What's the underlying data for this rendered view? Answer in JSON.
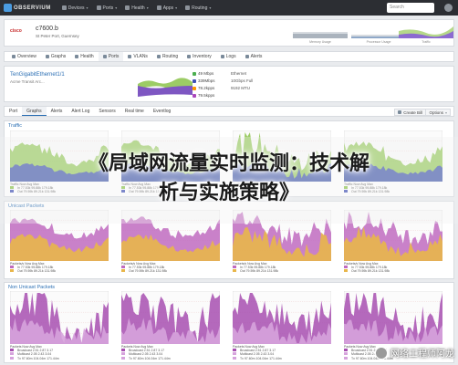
{
  "topbar": {
    "logo": "OBSERVIUM",
    "nav": [
      {
        "label": "Devices",
        "icon": "devices-icon"
      },
      {
        "label": "Ports",
        "icon": "ports-icon"
      },
      {
        "label": "Health",
        "icon": "health-icon"
      },
      {
        "label": "Apps",
        "icon": "apps-icon"
      },
      {
        "label": "Routing",
        "icon": "routing-icon"
      }
    ],
    "search_placeholder": "Search"
  },
  "device": {
    "vendor": "cisco",
    "name": "c7600.b",
    "location": "St Peter Port, Guernsey",
    "sparks": [
      {
        "label": "Memory Usage"
      },
      {
        "label": "Processor Usage"
      },
      {
        "label": "Traffic"
      }
    ]
  },
  "device_tabs": [
    "Overview",
    "Graphs",
    "Health",
    "Ports",
    "VLANs",
    "Routing",
    "Inventory",
    "Logs",
    "Alerts"
  ],
  "port": {
    "name": "TenGigabitEthernet1/1",
    "description": "Acme Transit Arc...",
    "stats": [
      "49 Mbps",
      "339Mbps",
      "78.2kpps",
      "79.5kpps"
    ],
    "meta": [
      "Ethernet",
      "10Gbps Full",
      "9192 MTU"
    ]
  },
  "port_tabs": [
    "Port",
    "Graphs",
    "Alerts",
    "Alert Log",
    "Sensors",
    "Real time",
    "Eventlog"
  ],
  "right_buttons": [
    "Create Bill",
    "Options"
  ],
  "sections": {
    "traffic": "Traffic",
    "unicast": "Unicast Packets",
    "nonunicast": "Non Unicast Packets"
  },
  "legend": {
    "traffic_header": "Traffic",
    "unicast_header": "Packets/s",
    "nonunicast_header": "Packets",
    "cols": [
      "Now",
      "Avg",
      "Max"
    ],
    "rows_traffic": [
      {
        "name": "In",
        "now": "77.53k",
        "avg": "95.88k",
        "max": "179.18k"
      },
      {
        "name": "Out",
        "now": "79.59k",
        "avg": "89.21k",
        "max": "131.98k"
      }
    ],
    "rows_nonunicast": [
      {
        "name": "Broadcast",
        "now": "2.51",
        "avg": "2.87",
        "max": "3.17"
      },
      {
        "name": "Multicast",
        "now": "2.05",
        "avg": "2.43",
        "max": "3.04"
      },
      {
        "name": "Tx",
        "now": "97.60m",
        "avg": "104.04m",
        "max": "171.44m"
      }
    ]
  },
  "headline": {
    "line1": "《局域网流量实时监测：技术解",
    "line2": "析与实施策略》"
  },
  "watermark": "网络工程师阿龙",
  "colors": {
    "in": "#8bc34a",
    "out": "#3f51b5",
    "unicast_in": "#e8b64a",
    "unicast_out": "#c06bbf",
    "nonunicast": "#a74fb0",
    "accent": "#2b6fb4"
  }
}
